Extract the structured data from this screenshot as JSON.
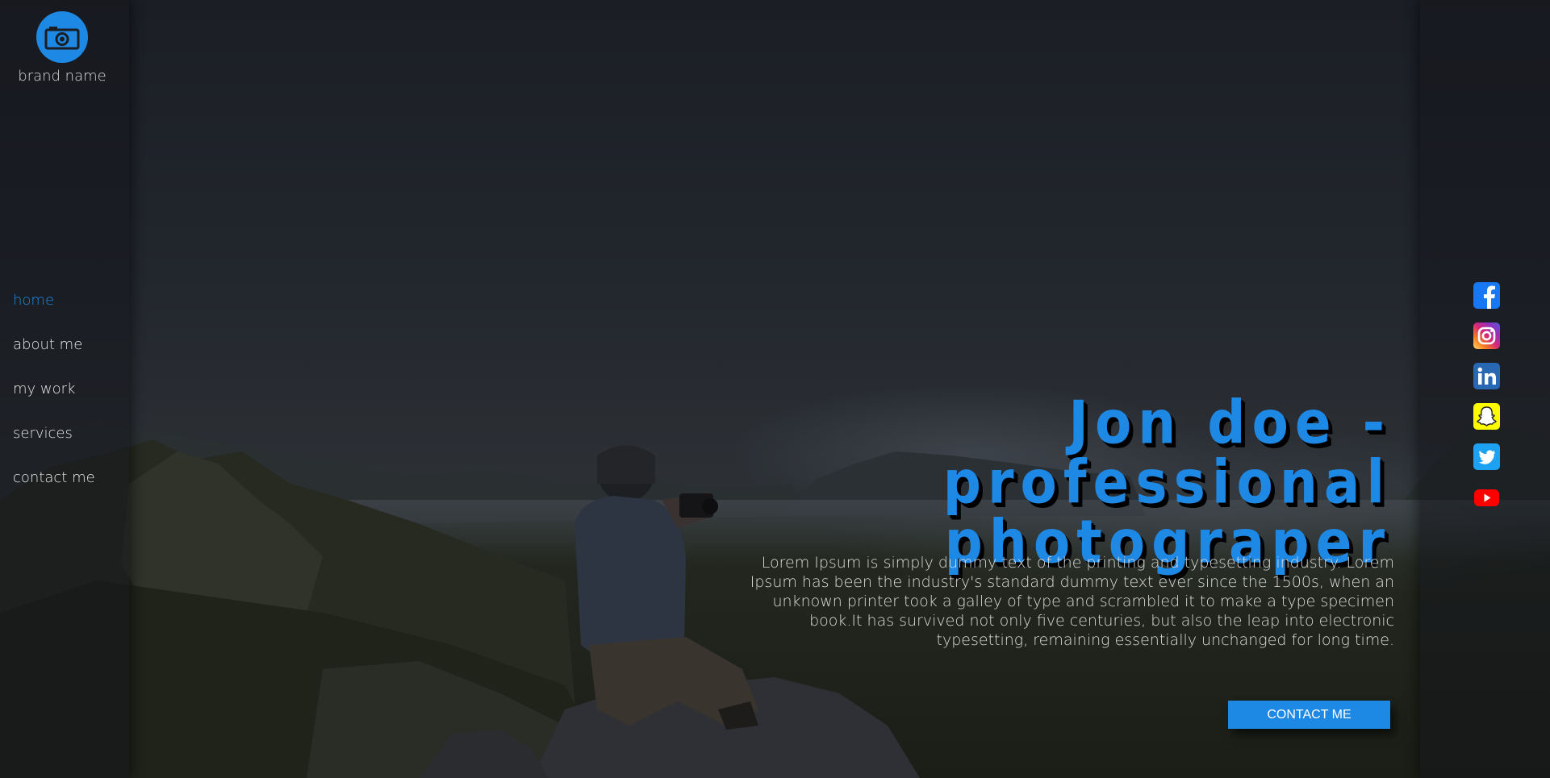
{
  "brand": {
    "name": "brand name",
    "logo_icon": "camera-icon",
    "accent": "#1e88e5"
  },
  "nav": {
    "items": [
      {
        "label": "home",
        "active": true
      },
      {
        "label": "about me",
        "active": false
      },
      {
        "label": "my work",
        "active": false
      },
      {
        "label": "services",
        "active": false
      },
      {
        "label": "contact me",
        "active": false
      }
    ]
  },
  "hero": {
    "title_line1": "Jon doe - professional",
    "title_line2": "photograper",
    "paragraph": "Lorem Ipsum is simply dummy text of the printing and typesetting industry. Lorem Ipsum has been the industry's standard dummy text ever since the 1500s, when an unknown printer took a galley of type and scrambled it to make a type specimen book.It has survived not only five centuries, but also the leap into electronic typesetting, remaining essentially unchanged for long time.",
    "cta_label": "CONTACT ME"
  },
  "social": [
    {
      "icon": "facebook-icon",
      "color": "#1877f2"
    },
    {
      "icon": "instagram-icon",
      "color": "#c13584"
    },
    {
      "icon": "linkedin-icon",
      "color": "#2867b2"
    },
    {
      "icon": "snapchat-icon",
      "color": "#fffc00"
    },
    {
      "icon": "twitter-icon",
      "color": "#1da1f2"
    },
    {
      "icon": "youtube-icon",
      "color": "#ff0000"
    }
  ]
}
